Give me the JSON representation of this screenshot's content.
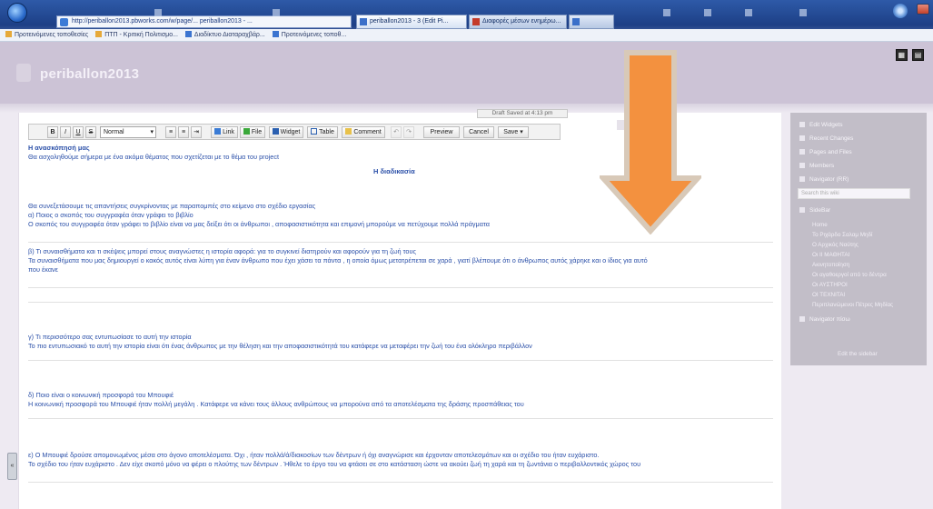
{
  "browser": {
    "address": "http://periballon2013.pbworks.com/w/page/... periballon2013 - ...",
    "tabs": [
      {
        "label": "periballon2013 - 3 (Edit Pi...",
        "active": true
      },
      {
        "label": "Διαφορές μέσων ενημέρω...",
        "active": false
      },
      {
        "label": "",
        "active": false
      }
    ],
    "favorites": [
      "Προτεινόμενες τοποθεσίες",
      "ΠΤΠ - Κριτική Πολιτισμο...",
      "Διαδίκτυο Διαταραχβάρ...",
      "Προτεινόμενες τοποθ..."
    ]
  },
  "site": {
    "title": "periballon2013",
    "header_icons": [
      "grid-icon",
      "menu-icon"
    ]
  },
  "editor": {
    "saved_status": "Draft Saved at 4:13 pm",
    "toolbar": {
      "bold": "B",
      "italic": "I",
      "underline": "U",
      "strike": "S",
      "format": "Normal",
      "link": "Link",
      "file": "File",
      "widget": "Widget",
      "table": "Table",
      "comment": "Comment",
      "preview": "Preview",
      "cancel": "Cancel",
      "save": "Save"
    },
    "heading": "Η ανασκόπησή μας",
    "intro": "Θα ασχοληθούμε σήμερα με ένα ακόμα θέματος που σχετίζεται με το θέμα του project",
    "center_title": "Η διαδικασία",
    "paragraphs": [
      [
        "Θα συνεξετάσουμε τις απαντήσεις συγκρίνοντας με παραπομπές στο κείμενο στο σχέδιο εργασίας",
        "α) Ποιος ο σκοπός του συγγραφέα όταν γράφει το βιβλίο",
        "Ο σκοπός του συγγραφέα όταν γράφει το βιβλίο είναι να μας δείξει ότι οι άνθρωποι , αποφασιστικότητα και επιμονή μπορούμε να πετύχουμε πολλά πράγματα"
      ],
      [
        "β) Τι συναισθήματα και τι σκέψεις μπορεί στους αναγνώστες η ιστορία αφορά: για το συγκινεί διατηρούν και αφορούν για τη ζωή τους",
        "Τα συναισθήματα που μας δημιουργεί ο κακός αυτός είναι λύπη για έναν άνθρωπο που έχει χάσει τα πάντα , η οποία όμως μετατρέπεται σε χαρά , γιατί βλέπουμε ότι ο άνθρωπος αυτός χάρηκε και ο ίδιος για αυτό",
        "που έκανε"
      ],
      [
        "γ) Τι περισσότερο σας εντυπωσίασε το αυτή την ιστορία",
        "Το πιο εντυπωσιακό το αυτή την ιστορία είναι ότι ένας άνθρωπος με την θέληση και την αποφασιστικότητά του κατάφερε να μεταφέρει την ζωή του ένα ολόκληρο περιβάλλον"
      ],
      [
        "δ) Ποιο είναι ο κοινωνική προσφορά του Μπουφιέ",
        "Η κοινωνική προσφορά του Μπουφιέ ήταν πολλή μεγάλη . Κατάφερε να κάνει τους άλλους ανθρώπους να μπορούνα από τα αποτελέσματα της δράσης προσπάθειας του"
      ],
      [
        "ε) Ο Μπουφιέ δρούσε απομονωμένος μέσα στο άγονο αποτελέσματα. Όχι , ήταν πολλά/ά/διακοσίων των δέντρων ή όχι αναγνώρισε και έρχονταν αποτελεσμάτων και οι σχέδιο του ήταν ευχάριστο.",
        "Το σχέδιο του ήταν ευχάριστο . Δεν είχε σκοπό μόνο να φέρει ο πλούτης των δέντρων . Ήθελε το έργο του να φτάσει σε στο κατάσταση ώστε να ακούει ζωή τη χαρά και τη ζωντάνια ο περιβαλλοντικός χώρος του"
      ]
    ]
  },
  "sidebar": {
    "items": [
      "Edit Widgets",
      "Recent Changes",
      "Pages and Files",
      "Members",
      "Navigator (RR)"
    ],
    "search_placeholder": "Search this wiki",
    "section": "SideBar",
    "sub_items": [
      "Home",
      "Το Ριχάρδο Σαλαμ Μηδί",
      "Ο Αρχικός Ναύτης",
      "Οι ΙΙ ΜΑΘΗΤΑΙ",
      "Ακινητοποίηση",
      "Οι αγαθοεργοί από το δέντρα",
      "Οι ΑΥΣΤΗΡΟΙ",
      "ΟΙ ΤΕΧΝΙΤΑΙ",
      "Περιπλανώμενοι Πέτρες Μηδίας"
    ],
    "more": "Navigator πίσω",
    "footer": "Edit the sidebar"
  },
  "colors": {
    "arrow_fill": "#f3913f",
    "arrow_border": "#d8c9b8",
    "site_header": "#ccc3d6",
    "text_link": "#2a4fa8"
  }
}
